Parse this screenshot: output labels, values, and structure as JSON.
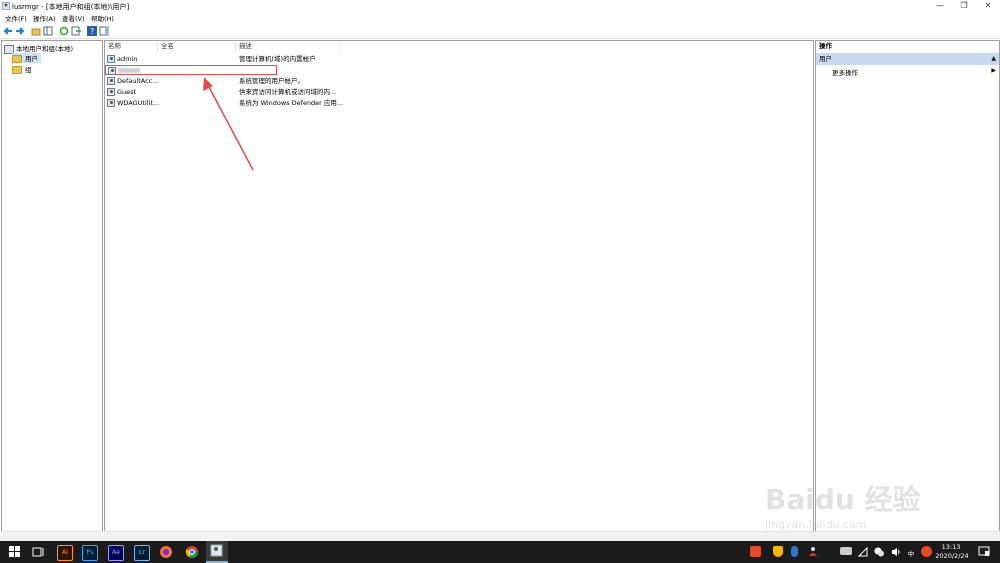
{
  "window": {
    "title": "lusrmgr - [本地用户和组(本地)\\用户]"
  },
  "menu": [
    "文件(F)",
    "操作(A)",
    "查看(V)",
    "帮助(H)"
  ],
  "tree": {
    "root": "本地用户和组(本地)",
    "users": "用户",
    "groups": "组"
  },
  "columns": {
    "name": "名称",
    "fullname": "全名",
    "desc": "描述"
  },
  "users": [
    {
      "name": "admin",
      "desc": "管理计算机(域)的内置帐户"
    },
    {
      "name": "",
      "desc": ""
    },
    {
      "name": "DefaultAcc...",
      "desc": "系统管理的用户帐户。"
    },
    {
      "name": "Guest",
      "desc": "供来宾访问计算机或访问域的内..."
    },
    {
      "name": "WDAGUtilit...",
      "desc": "系统为 Windows Defender 应用..."
    }
  ],
  "actions": {
    "header": "操作",
    "section": "用户",
    "more": "更多操作"
  },
  "tray": {
    "time": "13:13",
    "date": "2020/2/24",
    "ime": "中"
  },
  "taskbar_apps": [
    "Ai",
    "Ps",
    "Ae",
    "Lr"
  ],
  "watermark": {
    "brand": "Baidu 经验",
    "url": "jingyan.baidu.com"
  },
  "colors": {
    "highlight": "#c7d9ee",
    "annotation": "#e84a4a",
    "taskbar": "#1b1b1b"
  }
}
